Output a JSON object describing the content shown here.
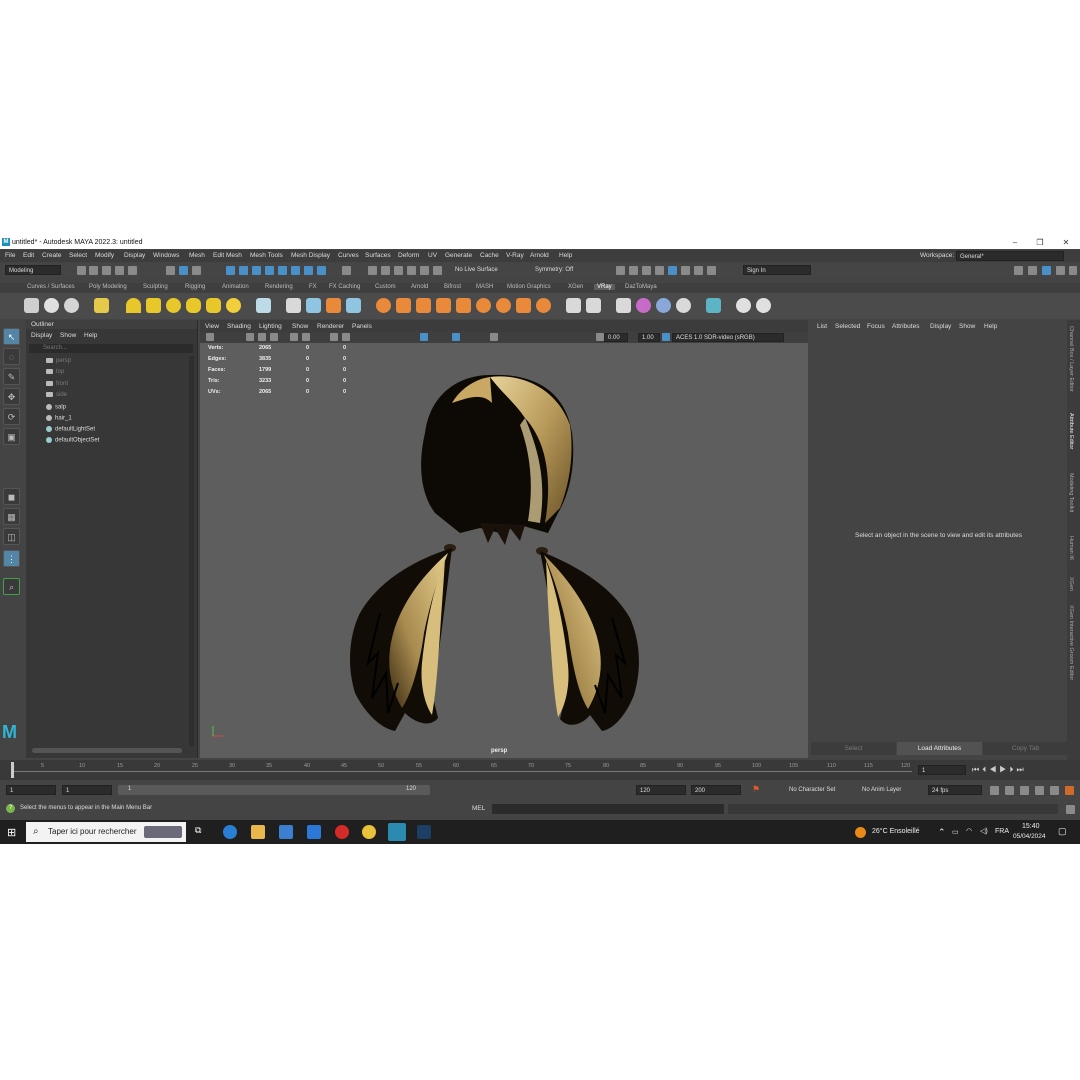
{
  "window": {
    "title": "untitled* - Autodesk MAYA 2022.3: untitled",
    "app_letter": "M"
  },
  "menu": [
    "File",
    "Edit",
    "Create",
    "Select",
    "Modify",
    "Display",
    "Windows",
    "Mesh",
    "Edit Mesh",
    "Mesh Tools",
    "Mesh Display",
    "Curves",
    "Surfaces",
    "Deform",
    "UV",
    "Generate",
    "Cache",
    "V-Ray",
    "Arnold",
    "Help"
  ],
  "workspace": {
    "label": "Workspace:",
    "value": "General*"
  },
  "toolbar": {
    "mode": "Modeling",
    "live_surface": "No Live Surface",
    "symmetry": "Symmetry: Off",
    "sign_in": "Sign In"
  },
  "shelf_tabs": [
    "Curves / Surfaces",
    "Poly Modeling",
    "Sculpting",
    "Rigging",
    "Animation",
    "Rendering",
    "FX",
    "FX Caching",
    "Custom",
    "Arnold",
    "Bifrost",
    "MASH",
    "Motion Graphics",
    "XGen",
    "VRay",
    "DazToMaya"
  ],
  "shelf_active": "VRay",
  "outliner": {
    "title": "Outliner",
    "menu": [
      "Display",
      "Show",
      "Help"
    ],
    "search_placeholder": "Search...",
    "items": [
      {
        "label": "persp",
        "dim": true
      },
      {
        "label": "top",
        "dim": true
      },
      {
        "label": "front",
        "dim": true
      },
      {
        "label": "side",
        "dim": true
      },
      {
        "label": "salp",
        "dim": false
      },
      {
        "label": "hair_1",
        "dim": false
      },
      {
        "label": "defaultLightSet",
        "dim": false
      },
      {
        "label": "defaultObjectSet",
        "dim": false
      }
    ]
  },
  "viewport": {
    "menu": [
      "View",
      "Shading",
      "Lighting",
      "Show",
      "Renderer",
      "Panels"
    ],
    "exposure": "0.00",
    "gamma": "1.00",
    "color_space": "ACES 1.0 SDR-video (sRGB)",
    "camera": "persp",
    "hud": [
      {
        "label": "Verts:",
        "a": "2065",
        "b": "0",
        "c": "0"
      },
      {
        "label": "Edges:",
        "a": "3835",
        "b": "0",
        "c": "0"
      },
      {
        "label": "Faces:",
        "a": "1799",
        "b": "0",
        "c": "0"
      },
      {
        "label": "Tris:",
        "a": "3233",
        "b": "0",
        "c": "0"
      },
      {
        "label": "UVs:",
        "a": "2065",
        "b": "0",
        "c": "0"
      }
    ]
  },
  "attribute_editor": {
    "menu": [
      "List",
      "Selected",
      "Focus",
      "Attributes",
      "Display",
      "Show",
      "Help"
    ],
    "message": "Select an object in the scene to view and edit its attributes",
    "buttons": [
      "Select",
      "Load Attributes",
      "Copy Tab"
    ]
  },
  "right_tabs": [
    "Channel Box / Layer Editor",
    "Attribute Editor",
    "Modeling Toolkit",
    "Human IK",
    "XGen",
    "XGen Interactive Groom Editor"
  ],
  "timeline": {
    "ticks": [
      "1",
      "5",
      "10",
      "15",
      "20",
      "25",
      "30",
      "35",
      "40",
      "45",
      "50",
      "55",
      "60",
      "65",
      "70",
      "75",
      "80",
      "85",
      "90",
      "95",
      "100",
      "105",
      "110",
      "115",
      "120"
    ],
    "current_frame": "1"
  },
  "range": {
    "start": "1",
    "start_inner": "1",
    "slider_start": "1",
    "slider_end": "120",
    "end_inner": "120",
    "end": "200",
    "character_set": "No Character Set",
    "anim_layer": "No Anim Layer",
    "fps": "24 fps"
  },
  "command": {
    "lang": "MEL",
    "help": "Select the menus to appear in the Main Menu Bar"
  },
  "taskbar": {
    "search": "Taper ici pour rechercher",
    "weather": "26°C  Ensoleillé",
    "lang": "FRA",
    "time": "15:40",
    "date": "05/04/2024"
  }
}
